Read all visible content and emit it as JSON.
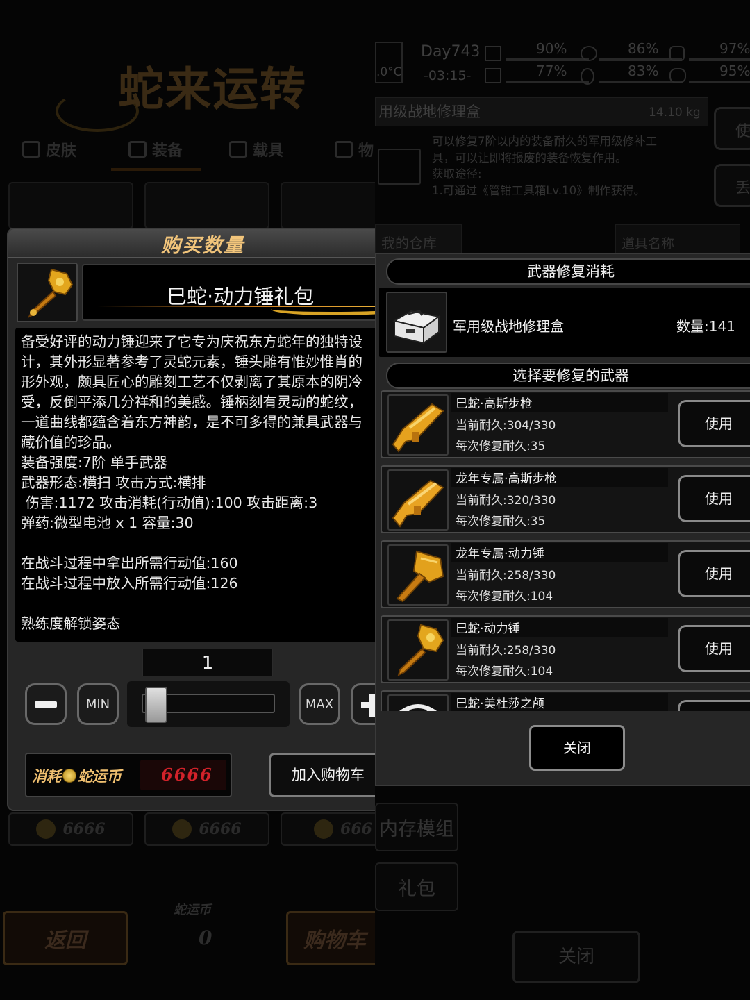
{
  "left_bg": {
    "title": "蛇来运转",
    "tabs": [
      "皮肤",
      "装备",
      "载具",
      "物"
    ],
    "price_cards": [
      "6666",
      "6666",
      "666"
    ],
    "back_label": "返回",
    "coin_label": "蛇运币",
    "coin_value": "0",
    "cart_label": "购物车"
  },
  "buy_dialog": {
    "title": "购买数量",
    "item_name": "巳蛇·动力锤礼包",
    "description": "备受好评的动力锤迎来了它专为庆祝东方蛇年的独特设\n计，其外形显著参考了灵蛇元素，锤头雕有惟妙惟肖的\n形外观，颇具匠心的雕刻工艺不仅剥离了其原本的阴冷\n受，反倒平添几分祥和的美感。锤柄刻有灵动的蛇纹，\n一道曲线都蕴含着东方神韵，是不可多得的兼具武器与\n藏价值的珍品。\n装备强度:7阶 单手武器\n武器形态:横扫 攻击方式:横排\n 伤害:1172 攻击消耗(行动值):100 攻击距离:3\n弹药:微型电池 x 1 容量:30\n\n在战斗过程中拿出所需行动值:160\n在战斗过程中放入所需行动值:126\n\n熟练度解锁姿态",
    "quantity": "1",
    "min_label": "MIN",
    "max_label": "MAX",
    "cost_label_1": "消耗",
    "cost_label_2": "蛇运币",
    "cost_value": "6666",
    "add_to_cart": "加入购物车",
    "slider_fraction": 0.0
  },
  "right_bg": {
    "status": {
      "day": "Day743",
      "temp": ".0°C",
      "time": "-03:15-",
      "pcts": [
        "90%",
        "86%",
        "97%",
        "77%",
        "83%",
        "95%"
      ]
    },
    "item_header": "用级战地修理盒",
    "weight": "14.10 kg",
    "side_btn_1": "使",
    "side_btn_2": "丢",
    "item_desc": "可以修复7阶以内的装备耐久的军用级修补工\n具，可以让即将报废的装备恢复作用。\n获取途径:\n1.可通过《管钳工具箱Lv.10》制作获得。",
    "warehouse": "我的仓库",
    "search_placeholder": "道具名称",
    "side_items": [
      "内存模组",
      "礼包"
    ],
    "close": "关闭"
  },
  "repair_dialog": {
    "cost_header": "武器修复消耗",
    "kit_name": "军用级战地修理盒",
    "kit_qty": "数量:141",
    "select_header": "选择要修复的武器",
    "weapons": [
      {
        "name": "巳蛇·高斯步枪",
        "durability": "当前耐久:304/330",
        "per_repair": "每次修复耐久:35",
        "use": "使用",
        "icon": "gauss-rifle-icon"
      },
      {
        "name": "龙年专属·高斯步枪",
        "durability": "当前耐久:320/330",
        "per_repair": "每次修复耐久:35",
        "use": "使用",
        "icon": "gauss-rifle-icon"
      },
      {
        "name": "龙年专属·动力锤",
        "durability": "当前耐久:258/330",
        "per_repair": "每次修复耐久:104",
        "use": "使用",
        "icon": "power-hammer-icon"
      },
      {
        "name": "巳蛇·动力锤",
        "durability": "当前耐久:258/330",
        "per_repair": "每次修复耐久:104",
        "use": "使用",
        "icon": "power-hammer-icon"
      },
      {
        "name": "巳蛇·美杜莎之颅",
        "durability": "",
        "per_repair": "",
        "use": "",
        "icon": "medusa-head-icon"
      }
    ],
    "close": "关闭"
  },
  "colors": {
    "gold": "#f2c57b",
    "cost_red": "#d2222a",
    "panel": "#262626"
  }
}
